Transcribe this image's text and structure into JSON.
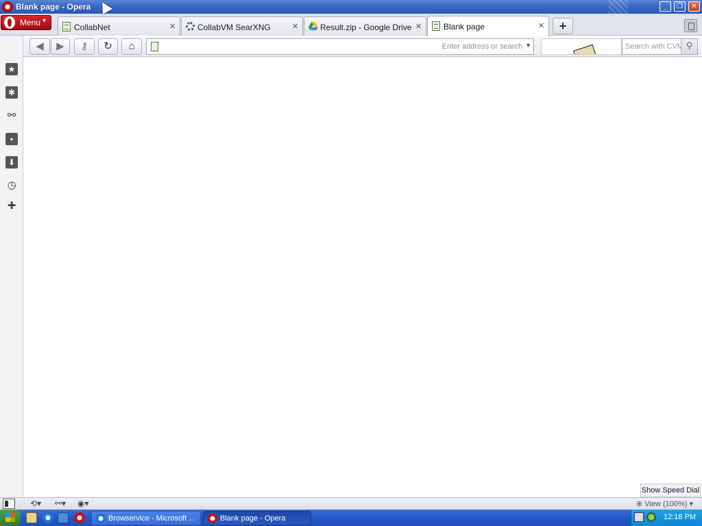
{
  "window": {
    "title": "Blank page - Opera"
  },
  "menu": {
    "label": "Menu"
  },
  "tabs": [
    {
      "label": "CollabNet",
      "icon": "page-icon",
      "active": false
    },
    {
      "label": "CollabVM SearXNG",
      "icon": "searxng-gear-icon",
      "active": false
    },
    {
      "label": "Result.zip - Google Drive",
      "icon": "google-drive-icon",
      "active": false
    },
    {
      "label": "Blank page",
      "icon": "page-icon",
      "active": true
    }
  ],
  "toolbar": {
    "address_placeholder": "Enter address or search",
    "address_value": "",
    "search_placeholder": "Search with CVM"
  },
  "sidebar": {
    "items": [
      "bookmarks-icon",
      "settings-icon",
      "unite-icon",
      "notes-icon",
      "downloads-icon",
      "history-icon",
      "add-panel-icon"
    ]
  },
  "statusbar": {
    "speed_dial_tooltip": "Show Speed Dial",
    "zoom_label": "View (100%)"
  },
  "taskbar": {
    "tasks": [
      {
        "label": "Browservice - Microsoft ...",
        "active": false
      },
      {
        "label": "Blank page - Opera",
        "active": true
      }
    ],
    "clock": "12:18 PM"
  },
  "colors": {
    "titlebar": "#3a6bc8",
    "opera_red": "#cc0f16",
    "taskbar": "#2457c8",
    "tray": "#0d86d6"
  }
}
